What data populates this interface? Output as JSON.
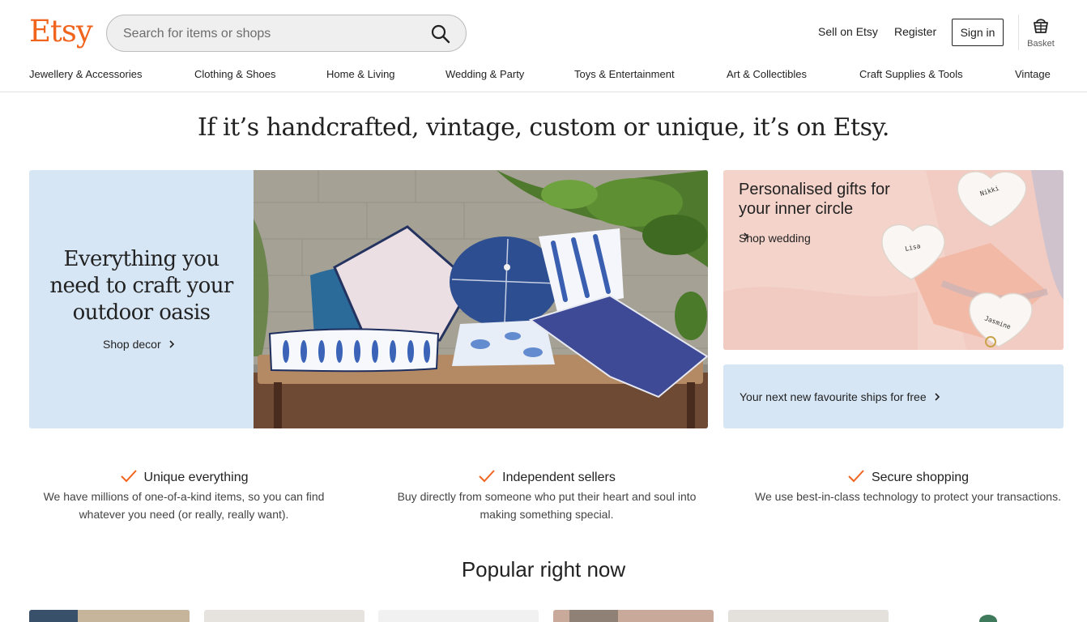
{
  "header": {
    "logo": "Etsy",
    "search": {
      "placeholder": "Search for items or shops",
      "value": ""
    },
    "sell": "Sell on Etsy",
    "register": "Register",
    "signin": "Sign in",
    "basket": "Basket"
  },
  "categories": [
    "Jewellery & Accessories",
    "Clothing & Shoes",
    "Home & Living",
    "Wedding & Party",
    "Toys & Entertainment",
    "Art & Collectibles",
    "Craft Supplies & Tools",
    "Vintage"
  ],
  "tagline": "If it’s handcrafted, vintage, custom or unique, it’s on Etsy.",
  "hero": {
    "title": "Everything you need to craft your outdoor oasis",
    "link": "Shop decor"
  },
  "promo": {
    "title": "Personalised gifts for your inner circle",
    "link": "Shop wedding",
    "dish_names": [
      "Nikki",
      "Lisa",
      "Jasmine"
    ]
  },
  "shipping": {
    "text": "Your next new favourite ships for free"
  },
  "features": [
    {
      "title": "Unique everything",
      "desc": "We have millions of one-of-a-kind items, so you can find whatever you need (or really, really want)."
    },
    {
      "title": "Independent sellers",
      "desc": "Buy directly from someone who put their heart and soul into making something special."
    },
    {
      "title": "Secure shopping",
      "desc": "We use best-in-class technology to protect your transactions."
    }
  ],
  "popular": {
    "title": "Popular right now"
  },
  "colors": {
    "brand": "#f1641e",
    "hero_bg": "#d7e6f5",
    "text": "#222222"
  },
  "icons": {
    "search": "search-icon",
    "basket": "basket-icon",
    "chevron": "chevron-right-icon",
    "check": "checkmark-icon"
  }
}
